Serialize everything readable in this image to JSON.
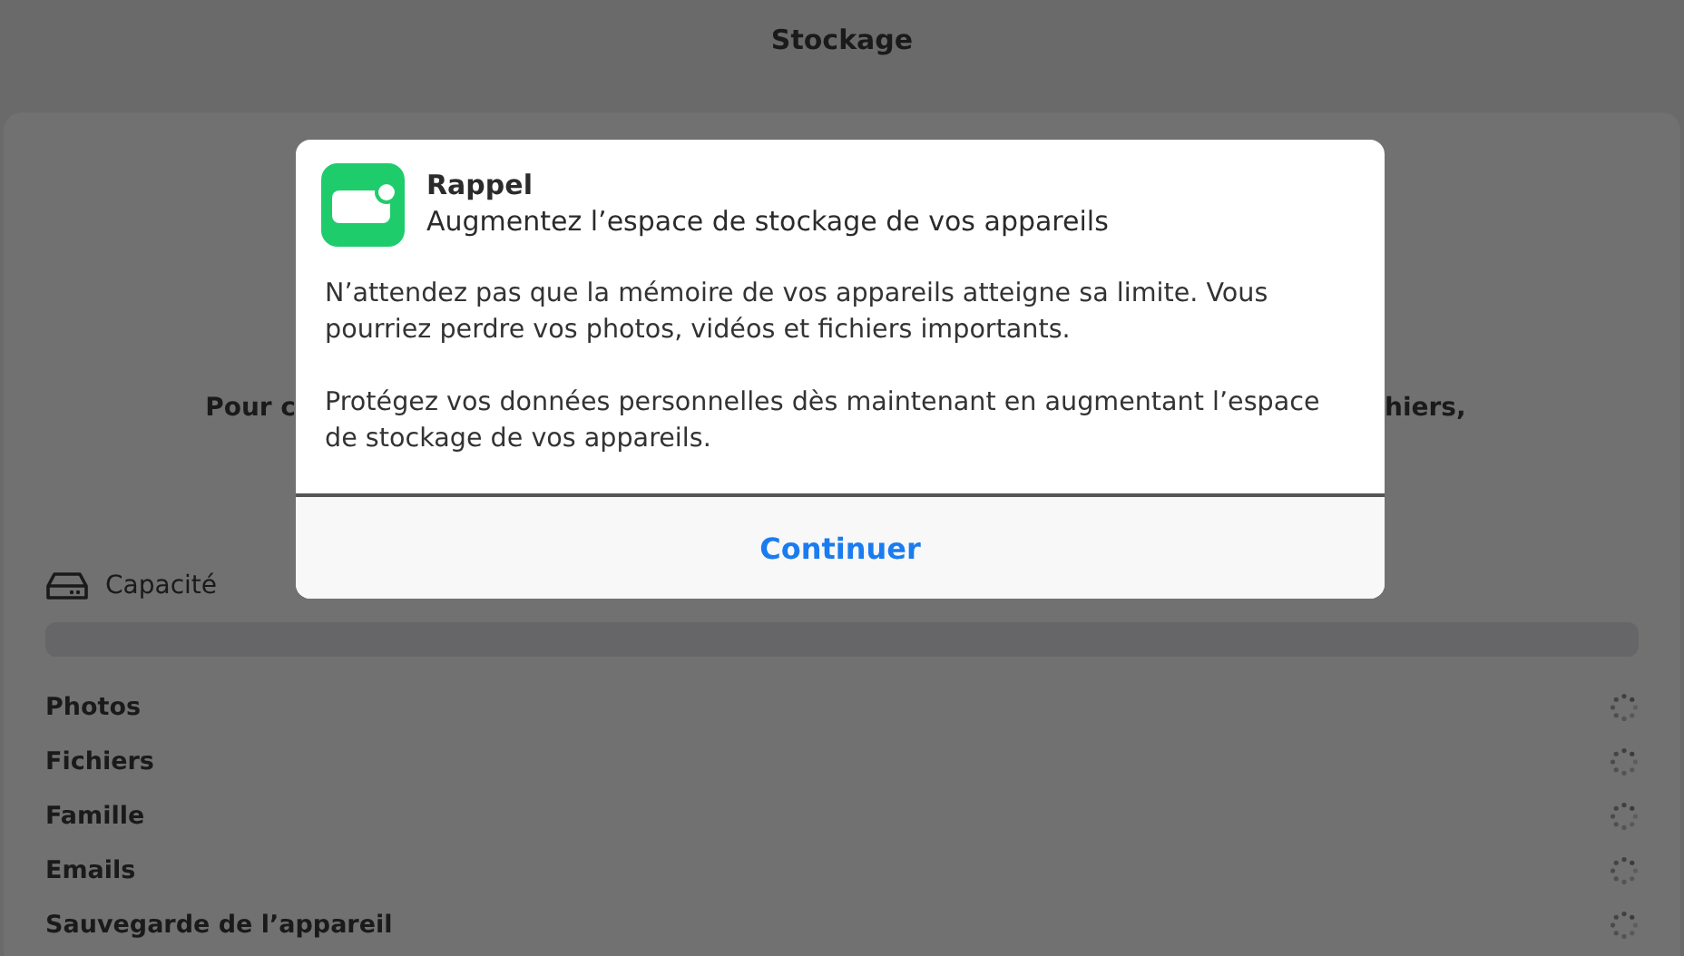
{
  "window": {
    "title": "Stockage"
  },
  "background_text": {
    "left_fragment": "Pour c",
    "right_fragment": "hiers,"
  },
  "capacity": {
    "label": "Capacité"
  },
  "categories": [
    {
      "name": "Photos"
    },
    {
      "name": "Fichiers"
    },
    {
      "name": "Famille"
    },
    {
      "name": "Emails"
    },
    {
      "name": "Sauvegarde de l’appareil"
    }
  ],
  "dialog": {
    "title": "Rappel",
    "subtitle": "Augmentez l’espace de stockage de vos appareils",
    "paragraphs": [
      "N’attendez pas que la mémoire de vos appareils atteigne sa limite. Vous pourriez perdre vos photos, vidéos et fichiers importants.",
      "Protégez vos données personnelles dès maintenant en augmentant l’espace de stockage de vos appareils."
    ],
    "button": "Continuer"
  }
}
